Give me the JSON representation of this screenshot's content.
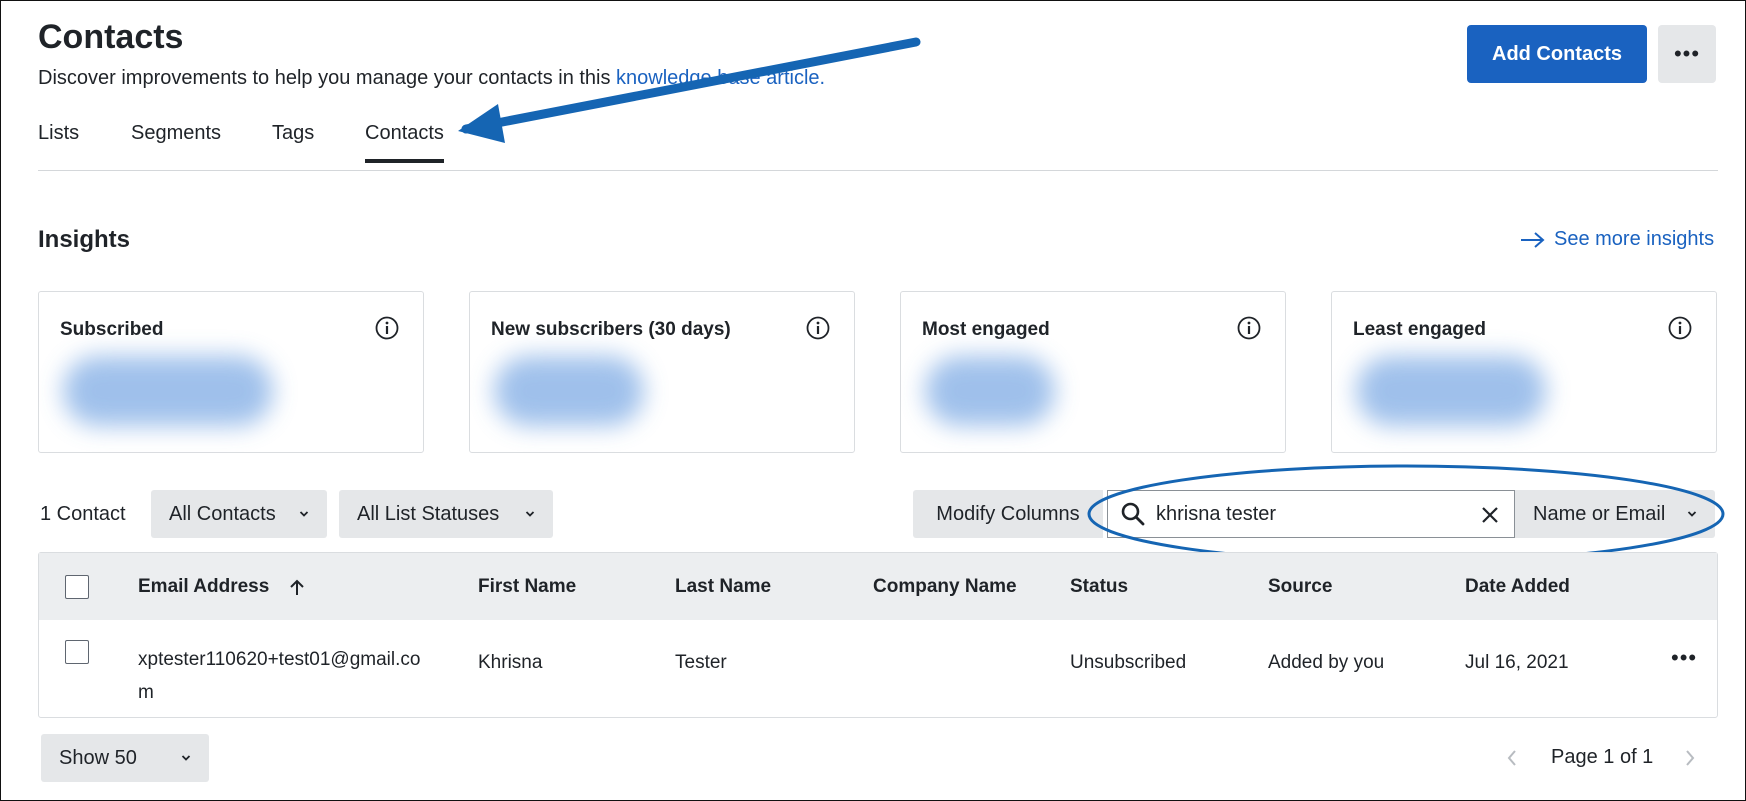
{
  "header": {
    "title": "Contacts",
    "subtitle_text": "Discover improvements to help you manage your contacts in this ",
    "subtitle_link": "knowledge base article.",
    "add_button": "Add Contacts",
    "more_label": "•••"
  },
  "tabs": [
    {
      "label": "Lists",
      "active": false
    },
    {
      "label": "Segments",
      "active": false
    },
    {
      "label": "Tags",
      "active": false
    },
    {
      "label": "Contacts",
      "active": true
    }
  ],
  "insights": {
    "title": "Insights",
    "see_more": "See more insights",
    "cards": [
      {
        "title": "Subscribed"
      },
      {
        "title": "New subscribers (30 days)"
      },
      {
        "title": "Most engaged"
      },
      {
        "title": "Least engaged"
      }
    ]
  },
  "filters": {
    "count": "1 Contact",
    "contacts_filter": "All Contacts",
    "status_filter": "All List Statuses",
    "modify_columns": "Modify Columns",
    "search_value": "khrisna tester",
    "search_mode": "Name or Email"
  },
  "table": {
    "headers": [
      "Email Address",
      "First Name",
      "Last Name",
      "Company Name",
      "Status",
      "Source",
      "Date Added"
    ],
    "rows": [
      {
        "email_line1": "xptester110620+test01@gmail.co",
        "email_line2": "m",
        "first_name": "Khrisna",
        "last_name": "Tester",
        "company": "",
        "status": "Unsubscribed",
        "source": "Added by you",
        "date_added": "Jul 16, 2021",
        "more": "•••"
      }
    ]
  },
  "footer": {
    "page_size": "Show 50",
    "pagination": "Page 1 of 1"
  },
  "colors": {
    "primary": "#1a62c0",
    "annotation": "#1565b3"
  }
}
